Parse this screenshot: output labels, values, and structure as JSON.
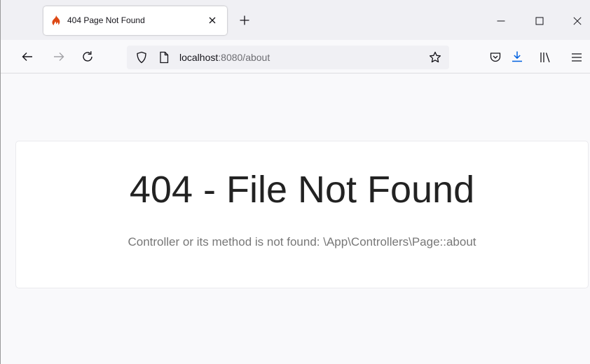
{
  "browser": {
    "tab": {
      "title": "404 Page Not Found",
      "favicon": "flame-icon"
    },
    "url": {
      "host": "localhost",
      "rest": ":8080/about"
    },
    "icons": {
      "back": "arrow-left-icon",
      "forward": "arrow-right-icon",
      "reload": "reload-icon",
      "tracking": "shield-icon",
      "page": "page-icon",
      "bookmark": "star-icon",
      "pocket": "pocket-icon",
      "downloads": "download-icon",
      "library": "library-icon",
      "menu": "hamburger-menu-icon"
    }
  },
  "page": {
    "title": "404 - File Not Found",
    "message": "Controller or its method is not found: \\App\\Controllers\\Page::about"
  },
  "colors": {
    "favicon": "#dd4814",
    "download_accent": "#0061e0",
    "title_text": "#222222",
    "message_text": "#777777"
  }
}
